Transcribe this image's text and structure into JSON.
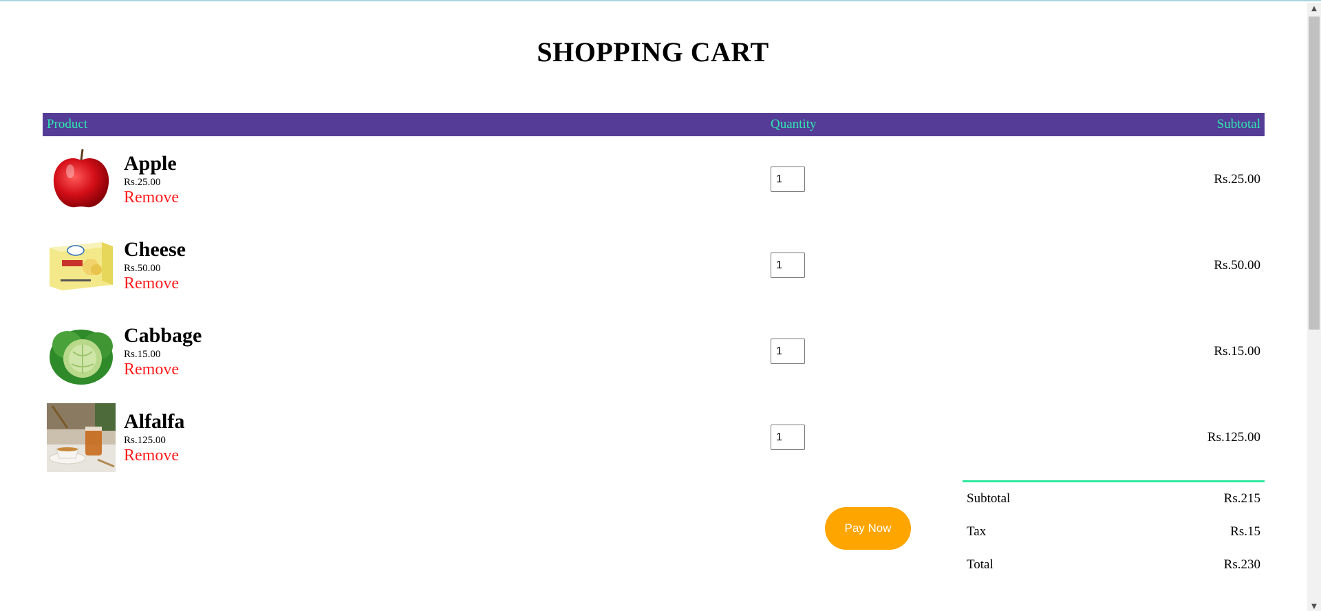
{
  "page": {
    "title": "SHOPPING CART"
  },
  "table": {
    "headers": {
      "product": "Product",
      "quantity": "Quantity",
      "subtotal": "Subtotal"
    },
    "header_bg": "#553d97",
    "header_text_color": "#2ee8b0"
  },
  "items": [
    {
      "name": "Apple",
      "price": "Rs.25.00",
      "remove_label": "Remove",
      "quantity": "1",
      "subtotal": "Rs.25.00",
      "image_icon": "apple-image"
    },
    {
      "name": "Cheese",
      "price": "Rs.50.00",
      "remove_label": "Remove",
      "quantity": "1",
      "subtotal": "Rs.50.00",
      "image_icon": "cheese-image"
    },
    {
      "name": "Cabbage",
      "price": "Rs.15.00",
      "remove_label": "Remove",
      "quantity": "1",
      "subtotal": "Rs.15.00",
      "image_icon": "cabbage-image"
    },
    {
      "name": "Alfalfa",
      "price": "Rs.125.00",
      "remove_label": "Remove",
      "quantity": "1",
      "subtotal": "Rs.125.00",
      "image_icon": "alfalfa-image"
    }
  ],
  "pay_button": {
    "label": "Pay Now",
    "color": "#ffa500"
  },
  "totals": {
    "subtotal_label": "Subtotal",
    "subtotal_value": "Rs.215",
    "tax_label": "Tax",
    "tax_value": "Rs.15",
    "total_label": "Total",
    "total_value": "Rs.230",
    "accent": "#2ee8a0"
  },
  "colors": {
    "remove_link": "#ff1a1a"
  }
}
